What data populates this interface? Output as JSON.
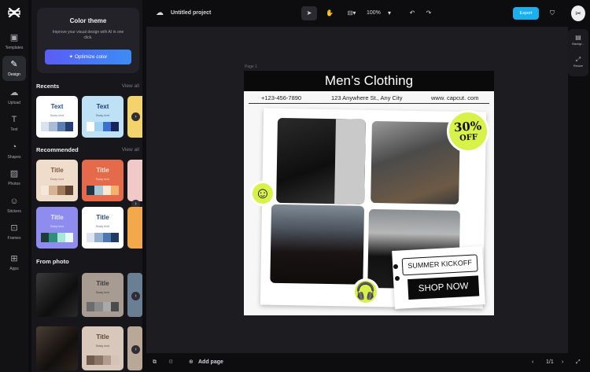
{
  "rail": {
    "items": [
      {
        "label": "Templates",
        "icon": "templates-icon"
      },
      {
        "label": "Design",
        "icon": "design-icon"
      },
      {
        "label": "Upload",
        "icon": "upload-icon"
      },
      {
        "label": "Text",
        "icon": "text-icon"
      },
      {
        "label": "Shapes",
        "icon": "shapes-icon"
      },
      {
        "label": "Photos",
        "icon": "photos-icon"
      },
      {
        "label": "Stickers",
        "icon": "stickers-icon"
      },
      {
        "label": "Frames",
        "icon": "frames-icon"
      },
      {
        "label": "Apps",
        "icon": "apps-icon"
      }
    ],
    "active": "Design"
  },
  "panel": {
    "color_theme": {
      "title": "Color theme",
      "description": "Improve your visual design with AI in one click.",
      "button": "Optimize color"
    },
    "recents": {
      "title": "Recents",
      "view_all": "View all",
      "cards": [
        {
          "title": "Text",
          "body": "Body text",
          "bg": "#ffffff",
          "title_color": "#2a4f86",
          "swatches": [
            "#d9e2ee",
            "#a9bcd6",
            "#5b7fb5",
            "#243f73"
          ]
        },
        {
          "title": "Text",
          "body": "Body text",
          "bg": "#bfe1f5",
          "title_color": "#1e3a7a",
          "swatches": [
            "#ffffff",
            "#9fd0ef",
            "#3b6fd4",
            "#18235c"
          ]
        }
      ]
    },
    "recommended": {
      "title": "Recommended",
      "view_all": "View all",
      "cards": [
        {
          "title": "Title",
          "body": "Body text",
          "bg": "#f0dccb",
          "title_color": "#7b5a3f",
          "swatches": [
            "#f5e7da",
            "#d6b394",
            "#a07a59",
            "#5e4330"
          ]
        },
        {
          "title": "Title",
          "body": "Body text",
          "bg": "#e46a4b",
          "title_color": "#fbe7d2",
          "swatches": [
            "#203446",
            "#a7c9d6",
            "#fbe7d2",
            "#f3b36b"
          ]
        },
        {
          "title": "Title",
          "body": "Body text",
          "bg": "#8f8cf0",
          "title_color": "#e6e7ff",
          "swatches": [
            "#1f3b3a",
            "#2f8f7f",
            "#a5e8d6",
            "#e9fbf6"
          ]
        },
        {
          "title": "Title",
          "body": "Body text",
          "bg": "#ffffff",
          "title_color": "#2d4a7a",
          "swatches": [
            "#dfe6f0",
            "#93aed0",
            "#4d77b0",
            "#213a66"
          ]
        }
      ]
    },
    "from_photo": {
      "title": "From photo",
      "cards": [
        {
          "title": "Title",
          "body": "Body text",
          "swatches": [
            "#6c6c6c",
            "#8a8a8a",
            "#a9a9a9",
            "#4b4b4b"
          ]
        },
        {
          "title": "Title",
          "body": "Body text",
          "swatches": [
            "#705a4c",
            "#8c7566",
            "#b19c8d",
            "#d5c3b6"
          ]
        }
      ]
    }
  },
  "topbar": {
    "project_title": "Untitled project",
    "zoom": "100%",
    "export_label": "Export"
  },
  "page": {
    "label": "Page 1",
    "header": "Men’s Clothing",
    "phone": "+123-456-7890",
    "address": "123 Anywhere St., Any City",
    "website": "www. capcut. com",
    "discount_line1": "30%",
    "discount_line2": "OFF",
    "summer": "SUMMER KICKOFF",
    "shop": "SHOP NOW"
  },
  "right_panel": {
    "background_label": "Backgr...",
    "resize_label": "Resize"
  },
  "bottombar": {
    "add_page": "Add page",
    "page_count": "1/1"
  }
}
